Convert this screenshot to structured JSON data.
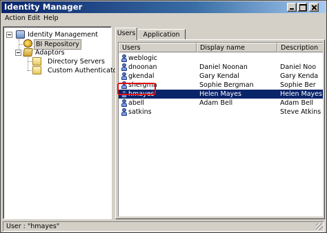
{
  "window": {
    "title": "Identity Manager"
  },
  "menu": {
    "action": "Action",
    "edit": "Edit",
    "help": "Help"
  },
  "tree": {
    "root": "Identity Management",
    "bi_repository": "BI Repository",
    "adaptors": "Adaptors",
    "directory_servers": "Directory Servers",
    "custom_authenticators": "Custom Authenticators",
    "selected": "BI Repository"
  },
  "tabs": {
    "users": "Users",
    "roles": "Application Roles",
    "active": "Users"
  },
  "columns": {
    "users": "Users",
    "display_name": "Display name",
    "description": "Description"
  },
  "users": [
    {
      "user": "weblogic",
      "display": "",
      "desc": ""
    },
    {
      "user": "dnoonan",
      "display": "Daniel Noonan",
      "desc": "Daniel Noo"
    },
    {
      "user": "gkendal",
      "display": "Gary Kendal",
      "desc": "Gary Kenda"
    },
    {
      "user": "shergma",
      "display": "Sophie Bergman",
      "desc": "Sophie Ber"
    },
    {
      "user": "hmayes",
      "display": "Helen Mayes",
      "desc": "Helen Mayes"
    },
    {
      "user": "abell",
      "display": "Adam Bell",
      "desc": "Adam Bell"
    },
    {
      "user": "satkins",
      "display": "",
      "desc": "Steve Atkins"
    }
  ],
  "selected_user": "hmayes",
  "status": {
    "text": "User : \"hmayes\""
  },
  "colors": {
    "title_start": "#0a246a",
    "selection": "#0a246a",
    "highlight_box": "#e01010",
    "chrome": "#d4d0c8"
  },
  "icons": {
    "tree_root": "identity-icon",
    "repository": "repository-icon",
    "adaptors": "adaptors-icon",
    "folder": "folder-icon",
    "user": "user-icon"
  }
}
